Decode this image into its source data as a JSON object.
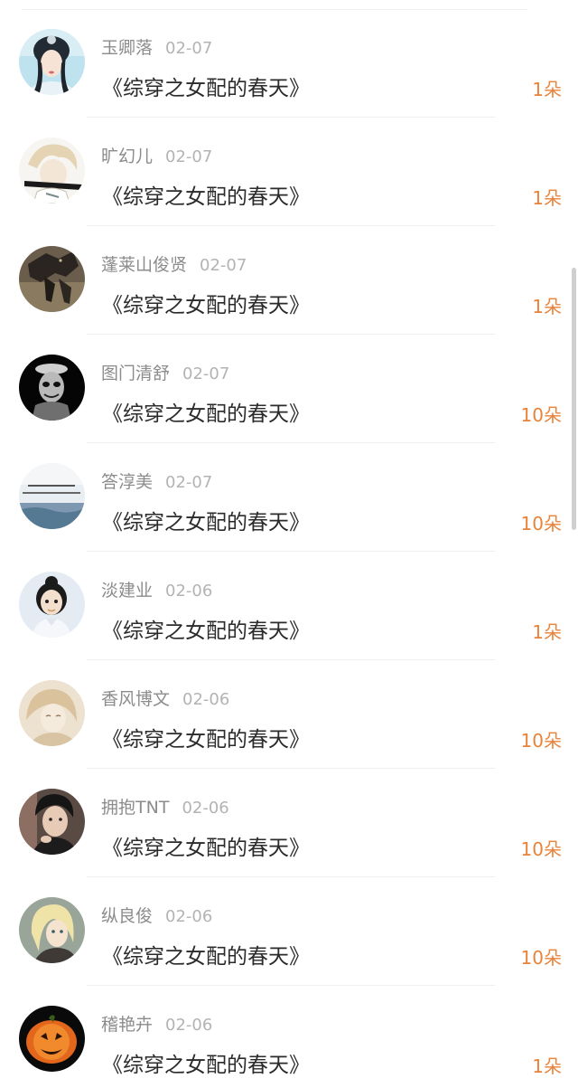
{
  "gifts": [
    {
      "user": "玉卿落",
      "date": "02-07",
      "book": "《综穿之女配的春天》",
      "amount": "1朵",
      "avatar": "avatar-girl-hanfu"
    },
    {
      "user": "旷幻儿",
      "date": "02-07",
      "book": "《综穿之女配的春天》",
      "amount": "1朵",
      "avatar": "avatar-anime-boy"
    },
    {
      "user": "蓬莱山俊贤",
      "date": "02-07",
      "book": "《综穿之女配的春天》",
      "amount": "1朵",
      "avatar": "avatar-crow"
    },
    {
      "user": "图门清舒",
      "date": "02-07",
      "book": "《综穿之女配的春天》",
      "amount": "10朵",
      "avatar": "avatar-dark-figure"
    },
    {
      "user": "答淳美",
      "date": "02-07",
      "book": "《综穿之女配的春天》",
      "amount": "10朵",
      "avatar": "avatar-sea-landscape"
    },
    {
      "user": "淡建业",
      "date": "02-06",
      "book": "《综穿之女配的春天》",
      "amount": "1朵",
      "avatar": "avatar-cartoon-girl"
    },
    {
      "user": "香风博文",
      "date": "02-06",
      "book": "《综穿之女配的春天》",
      "amount": "10朵",
      "avatar": "avatar-sketch-girl"
    },
    {
      "user": "拥抱TNT",
      "date": "02-06",
      "book": "《综穿之女配的春天》",
      "amount": "10朵",
      "avatar": "avatar-young-man"
    },
    {
      "user": "纵良俊",
      "date": "02-06",
      "book": "《综穿之女配的春天》",
      "amount": "10朵",
      "avatar": "avatar-anime-blonde"
    },
    {
      "user": "稽艳卉",
      "date": "02-06",
      "book": "《综穿之女配的春天》",
      "amount": "1朵",
      "avatar": "avatar-pumpkin"
    }
  ],
  "colors": {
    "accent": "#e8833a",
    "name": "#8c8c8c",
    "date": "#b3b3b3",
    "title": "#2b2b2b"
  }
}
